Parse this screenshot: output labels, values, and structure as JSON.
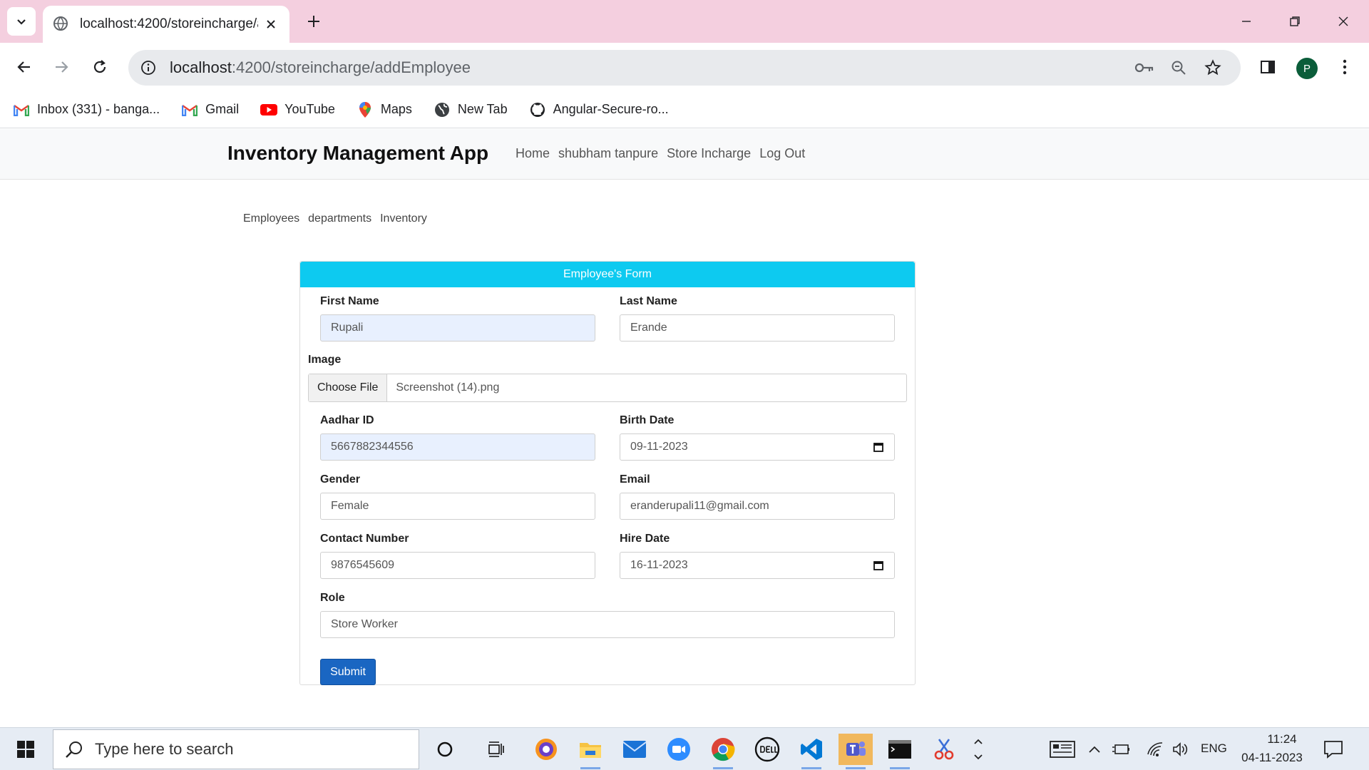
{
  "browser": {
    "tab": {
      "title": "localhost:4200/storeincharge/a"
    },
    "url": {
      "host": "localhost",
      "path": ":4200/storeincharge/addEmployee"
    },
    "profile_initial": "P",
    "bookmarks": [
      {
        "label": "Inbox (331) - banga...",
        "icon": "gmail-icon"
      },
      {
        "label": "Gmail",
        "icon": "gmail-icon"
      },
      {
        "label": "YouTube",
        "icon": "youtube-icon"
      },
      {
        "label": "Maps",
        "icon": "maps-icon"
      },
      {
        "label": "New Tab",
        "icon": "globe-icon"
      },
      {
        "label": "Angular-Secure-ro...",
        "icon": "github-icon"
      }
    ]
  },
  "app": {
    "brand": "Inventory Management App",
    "nav": [
      "Home",
      "shubham tanpure",
      "Store Incharge",
      "Log Out"
    ],
    "sub_nav": [
      "Employees",
      "departments",
      "Inventory"
    ]
  },
  "form": {
    "header": "Employee's Form",
    "first_name": {
      "label": "First Name",
      "value": "Rupali"
    },
    "last_name": {
      "label": "Last Name",
      "value": "Erande"
    },
    "image": {
      "label": "Image",
      "button": "Choose File",
      "file": "Screenshot (14).png"
    },
    "aadhar": {
      "label": "Aadhar ID",
      "value": "5667882344556"
    },
    "birth_date": {
      "label": "Birth Date",
      "value": "09-11-2023"
    },
    "gender": {
      "label": "Gender",
      "value": "Female"
    },
    "email": {
      "label": "Email",
      "value": "eranderupali11@gmail.com"
    },
    "contact": {
      "label": "Contact Number",
      "value": "9876545609"
    },
    "hire_date": {
      "label": "Hire Date",
      "value": "16-11-2023"
    },
    "role": {
      "label": "Role",
      "value": "Store Worker"
    },
    "submit": "Submit"
  },
  "taskbar": {
    "search_placeholder": "Type here to search",
    "language": "ENG",
    "time": "11:24",
    "date": "04-11-2023"
  },
  "colors": {
    "tab_strip": "#f4cfdf",
    "form_header": "#0dcaf0",
    "submit": "#1a66c2",
    "autofill": "#e8f0fe"
  }
}
